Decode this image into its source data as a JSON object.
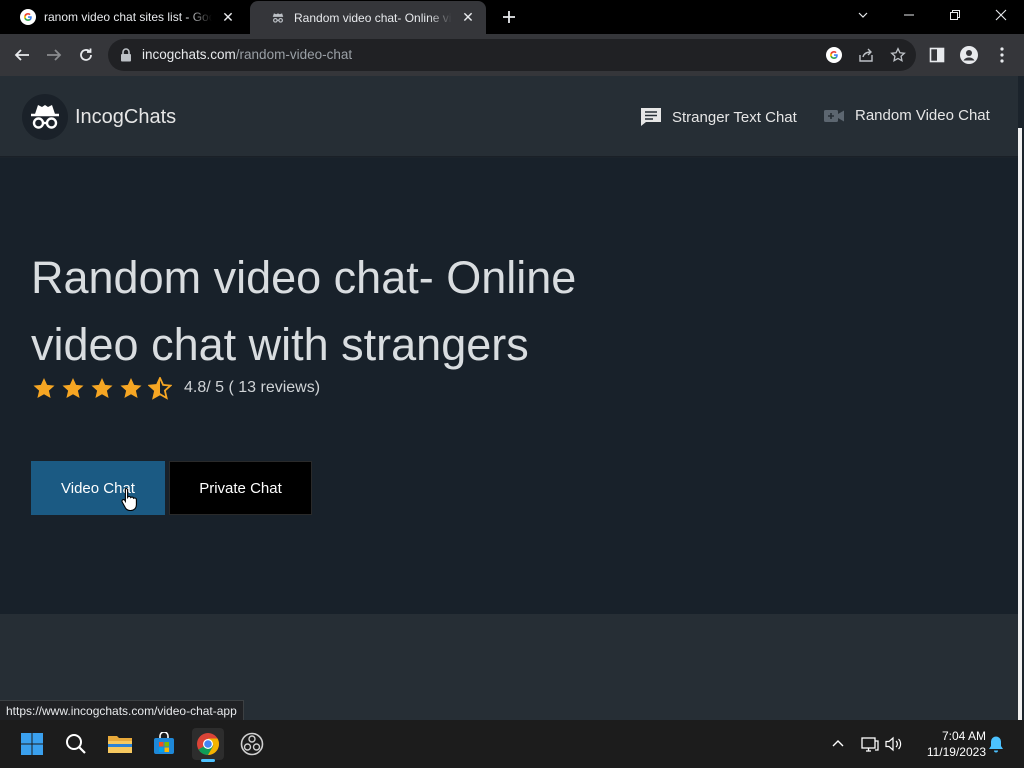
{
  "browser": {
    "tabs": [
      {
        "title": "ranom video chat sites list - Google Search",
        "favicon": "google-g-icon",
        "active": false
      },
      {
        "title": "Random video chat- Online video chat with strangers",
        "favicon": "incognito-icon",
        "active": true
      }
    ],
    "url_domain": "incogchats.com",
    "url_path": "/random-video-chat",
    "status_url": "https://www.incogchats.com/video-chat-app"
  },
  "site": {
    "name": "IncogChats",
    "nav": [
      {
        "label": "Stranger Text Chat",
        "icon": "chat-bubble-icon"
      },
      {
        "label": "Random Video Chat",
        "icon": "video-camera-icon"
      }
    ]
  },
  "hero": {
    "title": "Random video chat- Online video chat with strangers",
    "rating_value": 4.8,
    "rating_max": 5,
    "rating_text": "4.8/ 5 ( 13 reviews)",
    "buttons": {
      "video": "Video Chat",
      "private": "Private Chat"
    }
  },
  "colors": {
    "page_bg": "#18212a",
    "header_bg": "#262e35",
    "star": "#f6a623",
    "video_button": "#1b5a83",
    "private_button": "#000000"
  },
  "taskbar": {
    "apps": [
      "windows-start-icon",
      "search-icon",
      "file-explorer-icon",
      "microsoft-store-icon",
      "chrome-icon",
      "obs-icon"
    ],
    "time": "7:04 AM",
    "date": "11/19/2023"
  }
}
